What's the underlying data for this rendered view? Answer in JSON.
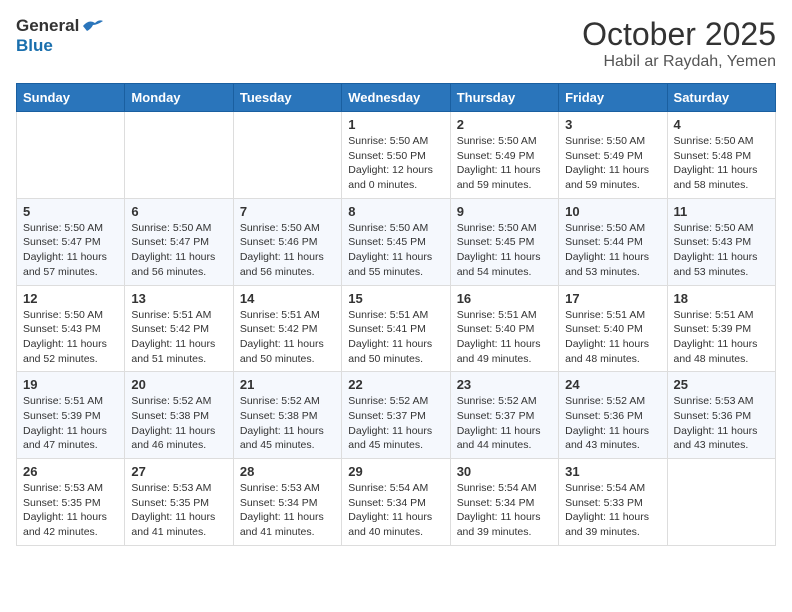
{
  "header": {
    "logo_general": "General",
    "logo_blue": "Blue",
    "month": "October 2025",
    "location": "Habil ar Raydah, Yemen"
  },
  "weekdays": [
    "Sunday",
    "Monday",
    "Tuesday",
    "Wednesday",
    "Thursday",
    "Friday",
    "Saturday"
  ],
  "weeks": [
    [
      {
        "day": "",
        "info": ""
      },
      {
        "day": "",
        "info": ""
      },
      {
        "day": "",
        "info": ""
      },
      {
        "day": "1",
        "info": "Sunrise: 5:50 AM\nSunset: 5:50 PM\nDaylight: 12 hours\nand 0 minutes."
      },
      {
        "day": "2",
        "info": "Sunrise: 5:50 AM\nSunset: 5:49 PM\nDaylight: 11 hours\nand 59 minutes."
      },
      {
        "day": "3",
        "info": "Sunrise: 5:50 AM\nSunset: 5:49 PM\nDaylight: 11 hours\nand 59 minutes."
      },
      {
        "day": "4",
        "info": "Sunrise: 5:50 AM\nSunset: 5:48 PM\nDaylight: 11 hours\nand 58 minutes."
      }
    ],
    [
      {
        "day": "5",
        "info": "Sunrise: 5:50 AM\nSunset: 5:47 PM\nDaylight: 11 hours\nand 57 minutes."
      },
      {
        "day": "6",
        "info": "Sunrise: 5:50 AM\nSunset: 5:47 PM\nDaylight: 11 hours\nand 56 minutes."
      },
      {
        "day": "7",
        "info": "Sunrise: 5:50 AM\nSunset: 5:46 PM\nDaylight: 11 hours\nand 56 minutes."
      },
      {
        "day": "8",
        "info": "Sunrise: 5:50 AM\nSunset: 5:45 PM\nDaylight: 11 hours\nand 55 minutes."
      },
      {
        "day": "9",
        "info": "Sunrise: 5:50 AM\nSunset: 5:45 PM\nDaylight: 11 hours\nand 54 minutes."
      },
      {
        "day": "10",
        "info": "Sunrise: 5:50 AM\nSunset: 5:44 PM\nDaylight: 11 hours\nand 53 minutes."
      },
      {
        "day": "11",
        "info": "Sunrise: 5:50 AM\nSunset: 5:43 PM\nDaylight: 11 hours\nand 53 minutes."
      }
    ],
    [
      {
        "day": "12",
        "info": "Sunrise: 5:50 AM\nSunset: 5:43 PM\nDaylight: 11 hours\nand 52 minutes."
      },
      {
        "day": "13",
        "info": "Sunrise: 5:51 AM\nSunset: 5:42 PM\nDaylight: 11 hours\nand 51 minutes."
      },
      {
        "day": "14",
        "info": "Sunrise: 5:51 AM\nSunset: 5:42 PM\nDaylight: 11 hours\nand 50 minutes."
      },
      {
        "day": "15",
        "info": "Sunrise: 5:51 AM\nSunset: 5:41 PM\nDaylight: 11 hours\nand 50 minutes."
      },
      {
        "day": "16",
        "info": "Sunrise: 5:51 AM\nSunset: 5:40 PM\nDaylight: 11 hours\nand 49 minutes."
      },
      {
        "day": "17",
        "info": "Sunrise: 5:51 AM\nSunset: 5:40 PM\nDaylight: 11 hours\nand 48 minutes."
      },
      {
        "day": "18",
        "info": "Sunrise: 5:51 AM\nSunset: 5:39 PM\nDaylight: 11 hours\nand 48 minutes."
      }
    ],
    [
      {
        "day": "19",
        "info": "Sunrise: 5:51 AM\nSunset: 5:39 PM\nDaylight: 11 hours\nand 47 minutes."
      },
      {
        "day": "20",
        "info": "Sunrise: 5:52 AM\nSunset: 5:38 PM\nDaylight: 11 hours\nand 46 minutes."
      },
      {
        "day": "21",
        "info": "Sunrise: 5:52 AM\nSunset: 5:38 PM\nDaylight: 11 hours\nand 45 minutes."
      },
      {
        "day": "22",
        "info": "Sunrise: 5:52 AM\nSunset: 5:37 PM\nDaylight: 11 hours\nand 45 minutes."
      },
      {
        "day": "23",
        "info": "Sunrise: 5:52 AM\nSunset: 5:37 PM\nDaylight: 11 hours\nand 44 minutes."
      },
      {
        "day": "24",
        "info": "Sunrise: 5:52 AM\nSunset: 5:36 PM\nDaylight: 11 hours\nand 43 minutes."
      },
      {
        "day": "25",
        "info": "Sunrise: 5:53 AM\nSunset: 5:36 PM\nDaylight: 11 hours\nand 43 minutes."
      }
    ],
    [
      {
        "day": "26",
        "info": "Sunrise: 5:53 AM\nSunset: 5:35 PM\nDaylight: 11 hours\nand 42 minutes."
      },
      {
        "day": "27",
        "info": "Sunrise: 5:53 AM\nSunset: 5:35 PM\nDaylight: 11 hours\nand 41 minutes."
      },
      {
        "day": "28",
        "info": "Sunrise: 5:53 AM\nSunset: 5:34 PM\nDaylight: 11 hours\nand 41 minutes."
      },
      {
        "day": "29",
        "info": "Sunrise: 5:54 AM\nSunset: 5:34 PM\nDaylight: 11 hours\nand 40 minutes."
      },
      {
        "day": "30",
        "info": "Sunrise: 5:54 AM\nSunset: 5:34 PM\nDaylight: 11 hours\nand 39 minutes."
      },
      {
        "day": "31",
        "info": "Sunrise: 5:54 AM\nSunset: 5:33 PM\nDaylight: 11 hours\nand 39 minutes."
      },
      {
        "day": "",
        "info": ""
      }
    ]
  ]
}
